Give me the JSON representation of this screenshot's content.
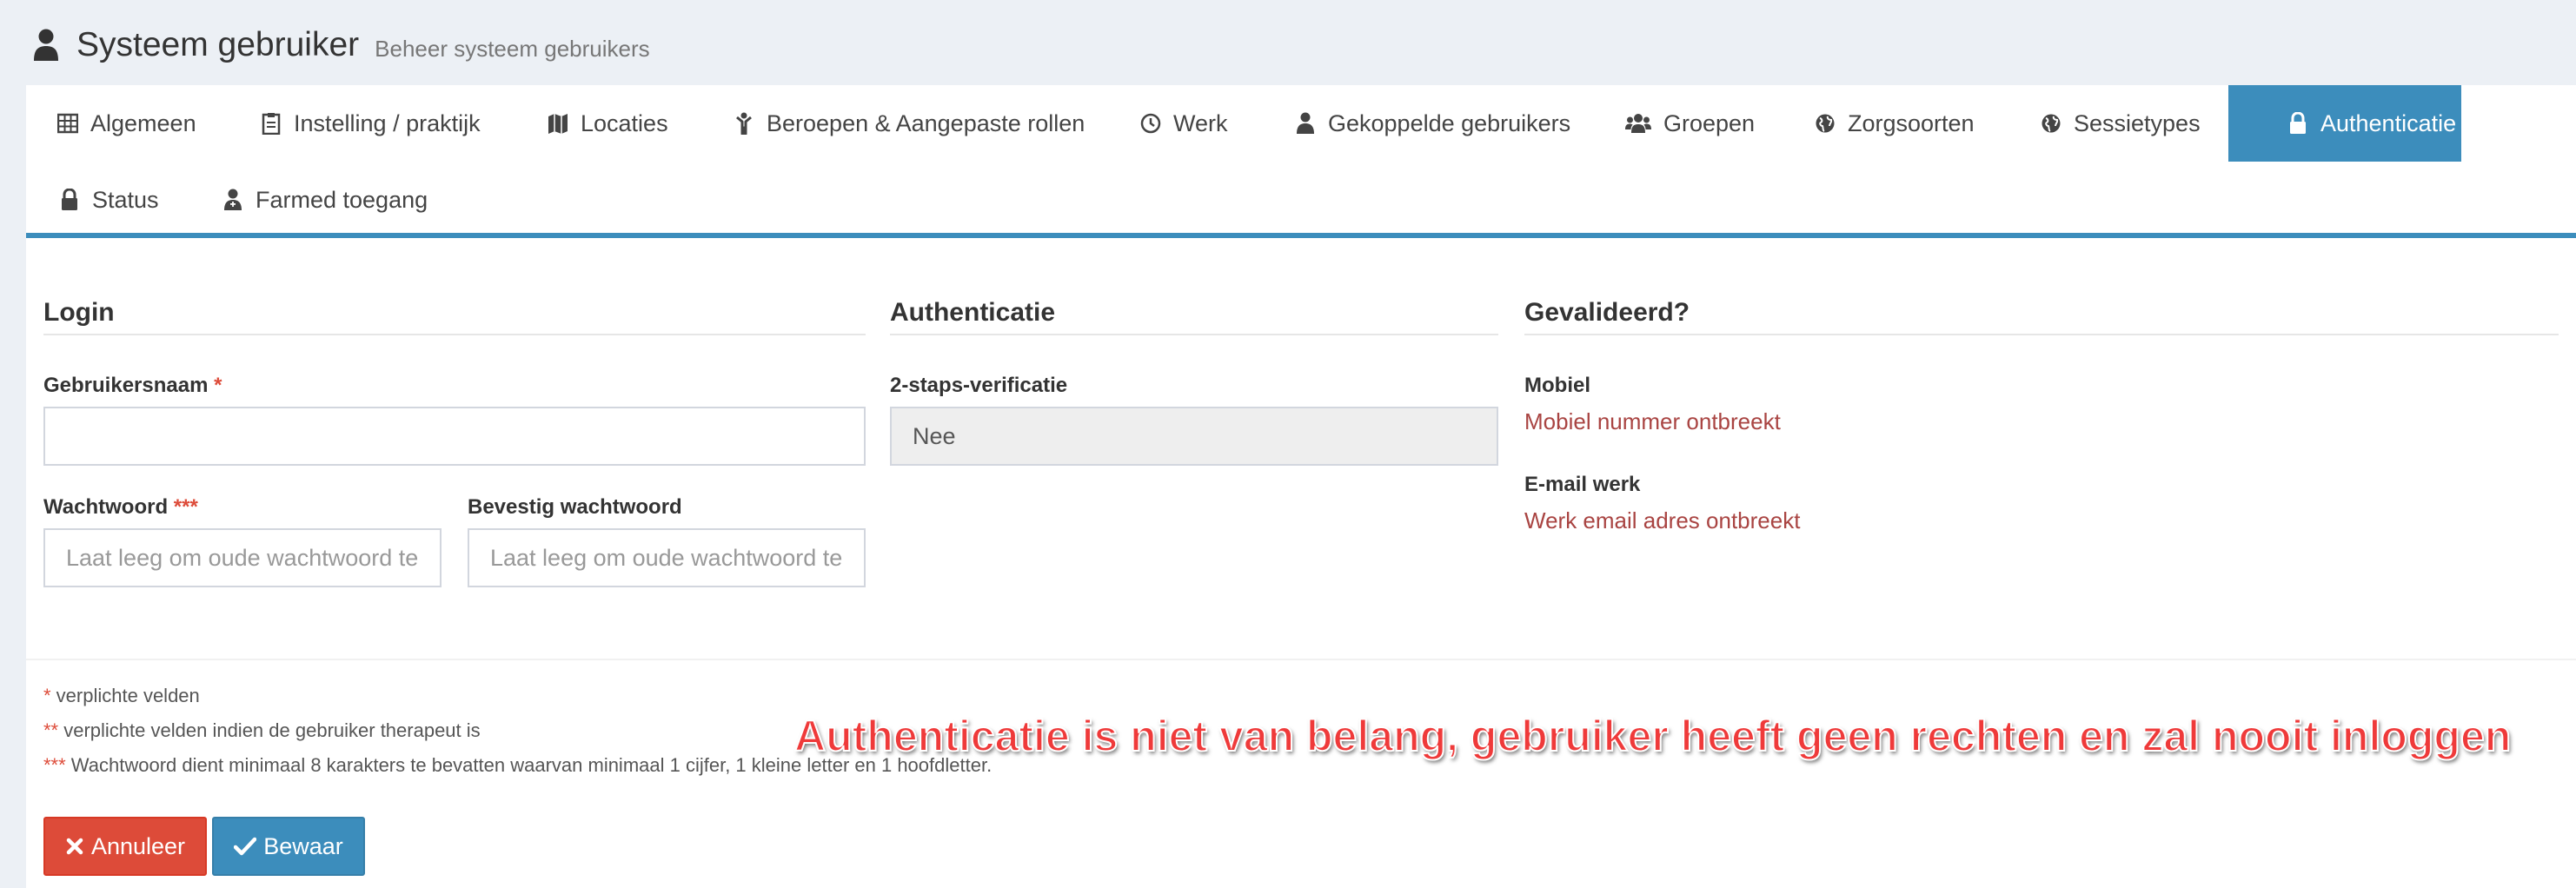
{
  "header": {
    "title": "Systeem gebruiker",
    "subtitle": "Beheer systeem gebruikers",
    "icon": "user-icon"
  },
  "tabs": [
    {
      "label": "Algemeen",
      "icon": "table-icon",
      "active": false
    },
    {
      "label": "Instelling / praktijk",
      "icon": "clipboard-icon",
      "active": false
    },
    {
      "label": "Locaties",
      "icon": "map-icon",
      "active": false
    },
    {
      "label": "Beroepen & Aangepaste rollen",
      "icon": "child-icon",
      "active": false
    },
    {
      "label": "Werk",
      "icon": "clock-icon",
      "active": false
    },
    {
      "label": "Gekoppelde gebruikers",
      "icon": "user-icon",
      "active": false
    },
    {
      "label": "Groepen",
      "icon": "users-icon",
      "active": false
    },
    {
      "label": "Zorgsoorten",
      "icon": "globe-icon",
      "active": false
    },
    {
      "label": "Sessietypes",
      "icon": "globe-icon",
      "active": false
    },
    {
      "label": "Authenticatie",
      "icon": "lock-icon",
      "active": true
    },
    {
      "label": "Status",
      "icon": "lock-icon",
      "active": false
    },
    {
      "label": "Farmed toegang",
      "icon": "user-md-icon",
      "active": false
    }
  ],
  "login": {
    "section_title": "Login",
    "username_label": "Gebruikersnaam",
    "username_req": "*",
    "username_value": "",
    "password_label": "Wachtwoord",
    "password_req": "***",
    "password_placeholder": "Laat leeg om oude wachtwoord te l",
    "confirm_label": "Bevestig wachtwoord",
    "confirm_placeholder": "Laat leeg om oude wachtwoord te l"
  },
  "auth": {
    "section_title": "Authenticatie",
    "two_step_label": "2-staps-verificatie",
    "two_step_value": "Nee"
  },
  "validated": {
    "section_title": "Gevalideerd?",
    "mobile_label": "Mobiel",
    "mobile_status": "Mobiel nummer ontbreekt",
    "email_label": "E-mail werk",
    "email_status": "Werk email adres ontbreekt"
  },
  "notes": [
    {
      "mark": "*",
      "text": " verplichte velden"
    },
    {
      "mark": "**",
      "text": " verplichte velden indien de gebruiker therapeut is"
    },
    {
      "mark": "***",
      "text": " Wachtwoord dient minimaal 8 karakters te bevatten waarvan minimaal 1 cijfer, 1 kleine letter en 1 hoofdletter."
    }
  ],
  "buttons": {
    "cancel_label": "Annuleer",
    "save_label": "Bewaar"
  },
  "annotation": "Authenticatie is niet van belang, gebruiker heeft geen rechten en zal nooit inloggen",
  "colors": {
    "primary": "#3c8dbc",
    "danger": "#dd4b39",
    "error_text": "#a94442",
    "annotation": "#ef3a3a"
  }
}
